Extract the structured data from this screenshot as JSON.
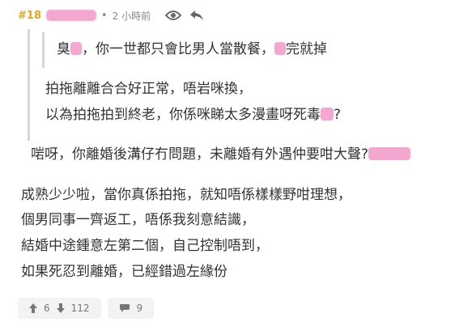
{
  "post": {
    "floor": "#18",
    "separator": "•",
    "time": "2 小時前"
  },
  "quote_inner": {
    "line": [
      "臭",
      "，你一世都只會比男人當散餐，",
      "完就掉"
    ]
  },
  "quote_outer": {
    "line1": "拍拖離離合合好正常，唔岩咪換，",
    "line2_text": "以為拍拖拍到終老，你係咪睇太多漫畫呀死毒",
    "line2_end": "?"
  },
  "quote_reply": {
    "line_text": "啱呀，你離婚後溝仔冇問題，未離婚有外遇仲要咁大聲?"
  },
  "body": {
    "lines": [
      "成熟少少啦，當你真係拍拖，就知唔係樣樣野咁理想，",
      "個男同事一齊返工，唔係我刻意結識，",
      "結婚中途鍾意左第二個，自己控制唔到，",
      "如果死忍到離婚，已經錯過左緣份"
    ]
  },
  "footer": {
    "upvotes": "6",
    "downvotes": "112",
    "comments": "9"
  },
  "icons": [
    "eye-icon",
    "reply-icon",
    "upvote-icon",
    "downvote-icon",
    "comment-icon"
  ],
  "colors": {
    "floor": "#e6a619",
    "censor": "#f4a7cf",
    "quote_border": "#d6d6d6"
  }
}
